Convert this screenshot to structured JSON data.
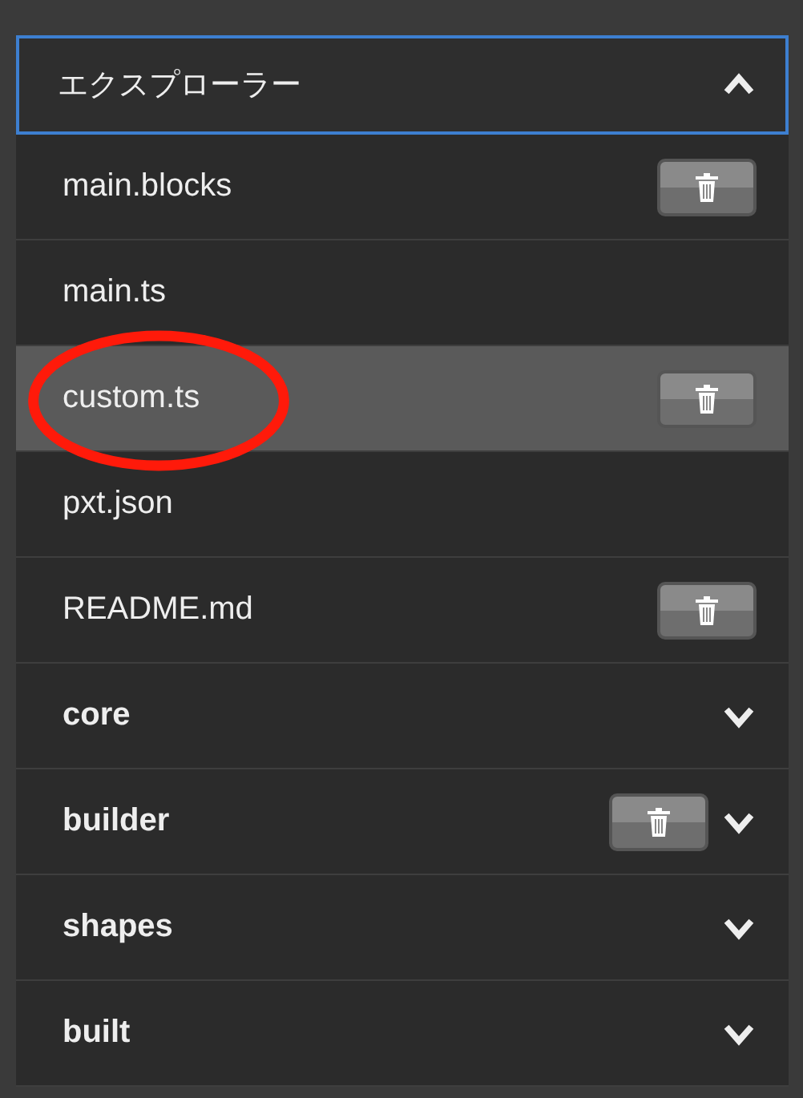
{
  "explorer": {
    "title": "エクスプローラー",
    "expanded": true,
    "items": [
      {
        "kind": "file",
        "name": "main.blocks",
        "selected": false,
        "deletable": true,
        "circled": false
      },
      {
        "kind": "file",
        "name": "main.ts",
        "selected": false,
        "deletable": false,
        "circled": false
      },
      {
        "kind": "file",
        "name": "custom.ts",
        "selected": true,
        "deletable": true,
        "circled": true
      },
      {
        "kind": "file",
        "name": "pxt.json",
        "selected": false,
        "deletable": false,
        "circled": false
      },
      {
        "kind": "file",
        "name": "README.md",
        "selected": false,
        "deletable": true,
        "circled": false
      },
      {
        "kind": "folder",
        "name": "core",
        "selected": false,
        "deletable": false,
        "expanded": false
      },
      {
        "kind": "folder",
        "name": "builder",
        "selected": false,
        "deletable": true,
        "expanded": false
      },
      {
        "kind": "folder",
        "name": "shapes",
        "selected": false,
        "deletable": false,
        "expanded": false
      },
      {
        "kind": "folder",
        "name": "built",
        "selected": false,
        "deletable": false,
        "expanded": false
      }
    ]
  }
}
